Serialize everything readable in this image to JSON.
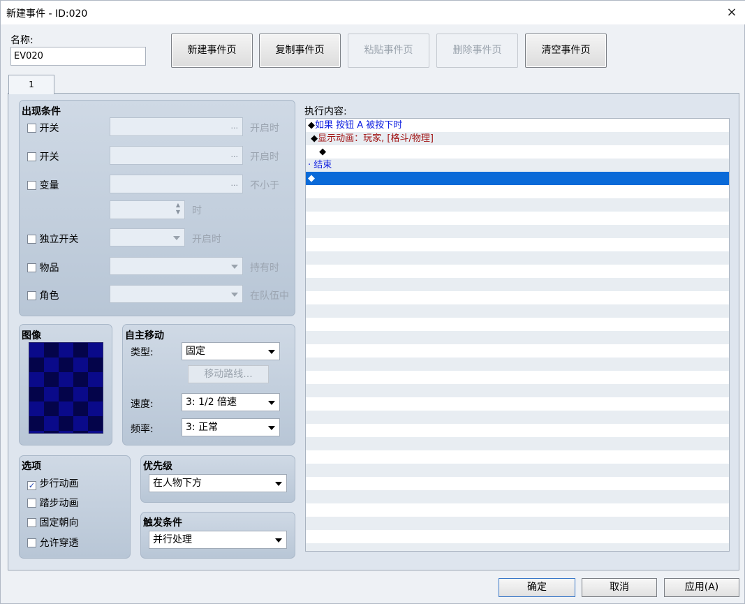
{
  "window": {
    "title": "新建事件 - ID:020",
    "close_icon": "×"
  },
  "name": {
    "label": "名称:",
    "value": "EV020"
  },
  "toolbar": {
    "new_page": "新建事件页",
    "copy_page": "复制事件页",
    "paste_page": "粘贴事件页",
    "delete_page": "删除事件页",
    "clear_page": "清空事件页"
  },
  "tabs": [
    {
      "label": "1"
    }
  ],
  "conditions": {
    "title": "出现条件",
    "switch1": {
      "label": "开关",
      "suffix": "开启时"
    },
    "switch2": {
      "label": "开关",
      "suffix": "开启时"
    },
    "variable": {
      "label": "变量",
      "suffix": "不小于",
      "suffix2": "时"
    },
    "self_switch": {
      "label": "独立开关",
      "suffix": "开启时"
    },
    "item": {
      "label": "物品",
      "suffix": "持有时"
    },
    "actor": {
      "label": "角色",
      "suffix": "在队伍中"
    },
    "dots": "..."
  },
  "image": {
    "title": "图像"
  },
  "movement": {
    "title": "自主移动",
    "type_label": "类型:",
    "type_value": "固定",
    "route_button": "移动路线...",
    "speed_label": "速度:",
    "speed_value": "3: 1/2 倍速",
    "freq_label": "频率:",
    "freq_value": "3: 正常"
  },
  "options": {
    "title": "选项",
    "walking": "步行动画",
    "stepping": "踏步动画",
    "direction_fix": "固定朝向",
    "through": "允许穿透"
  },
  "priority": {
    "title": "优先级",
    "value": "在人物下方"
  },
  "trigger": {
    "title": "触发条件",
    "value": "并行处理"
  },
  "contents": {
    "label": "执行内容:",
    "lines": [
      {
        "prefix": "◆",
        "text": "如果 按钮 A 被按下时",
        "color": "blue"
      },
      {
        "prefix": " ◆",
        "text": "显示动画：玩家, [格斗/物理]",
        "color": "red"
      },
      {
        "prefix": " ◆",
        "text": "",
        "color": "black"
      },
      {
        "prefix": "·",
        "text": "结束",
        "color": "blue"
      },
      {
        "prefix": "◆",
        "text": "",
        "color": "white"
      }
    ]
  },
  "footer": {
    "ok": "确定",
    "cancel": "取消",
    "apply": "应用(A)"
  }
}
